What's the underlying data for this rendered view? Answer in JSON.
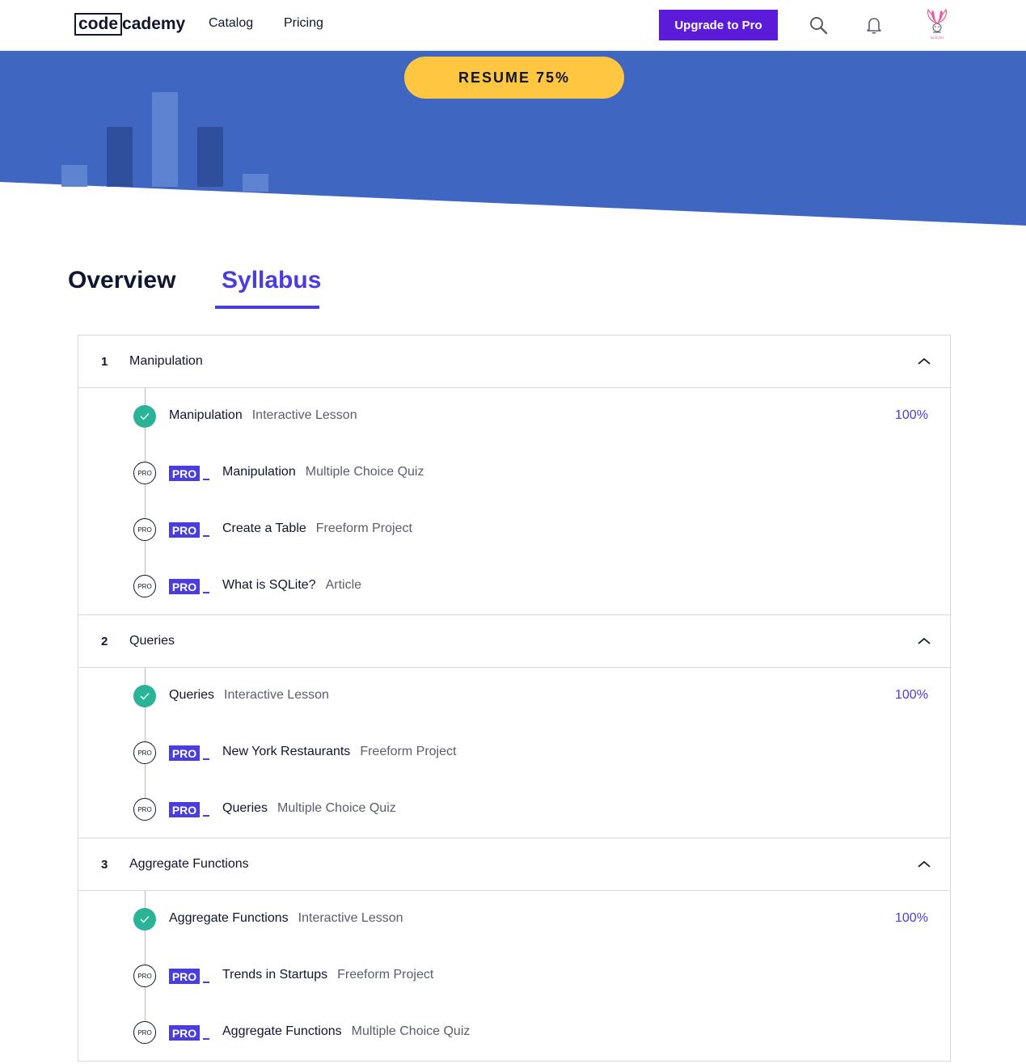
{
  "nav": {
    "logo_box": "code",
    "logo_rest": "cademy",
    "catalog": "Catalog",
    "pricing": "Pricing",
    "upgrade": "Upgrade to Pro",
    "avatar_caption": "luckyfer"
  },
  "hero": {
    "resume": "RESUME 75%",
    "progress_percent": 75
  },
  "tabs": {
    "overview": "Overview",
    "syllabus": "Syllabus",
    "active": "Syllabus"
  },
  "pro_icon_text": "PRO",
  "modules": [
    {
      "num": "1",
      "title": "Manipulation",
      "items": [
        {
          "title": "Manipulation",
          "type": "Interactive Lesson",
          "pro": false,
          "percent": "100%"
        },
        {
          "title": "Manipulation",
          "type": "Multiple Choice Quiz",
          "pro": true,
          "badge": "PRO"
        },
        {
          "title": "Create a Table",
          "type": "Freeform Project",
          "pro": true,
          "badge": "PRO"
        },
        {
          "title": "What is SQLite?",
          "type": "Article",
          "pro": true,
          "badge": "PRO"
        }
      ]
    },
    {
      "num": "2",
      "title": "Queries",
      "items": [
        {
          "title": "Queries",
          "type": "Interactive Lesson",
          "pro": false,
          "percent": "100%"
        },
        {
          "title": "New York Restaurants",
          "type": "Freeform Project",
          "pro": true,
          "badge": "PRO"
        },
        {
          "title": "Queries",
          "type": "Multiple Choice Quiz",
          "pro": true,
          "badge": "PRO"
        }
      ]
    },
    {
      "num": "3",
      "title": "Aggregate Functions",
      "items": [
        {
          "title": "Aggregate Functions",
          "type": "Interactive Lesson",
          "pro": false,
          "percent": "100%"
        },
        {
          "title": "Trends in Startups",
          "type": "Freeform Project",
          "pro": true,
          "badge": "PRO"
        },
        {
          "title": "Aggregate Functions",
          "type": "Multiple Choice Quiz",
          "pro": true,
          "badge": "PRO"
        }
      ]
    }
  ],
  "colors": {
    "brand_purple": "#5b1bd8",
    "accent": "#4a3de0",
    "hero_blue": "#3f66c0",
    "resume_yellow": "#ffc741",
    "done_green": "#2bb397"
  }
}
